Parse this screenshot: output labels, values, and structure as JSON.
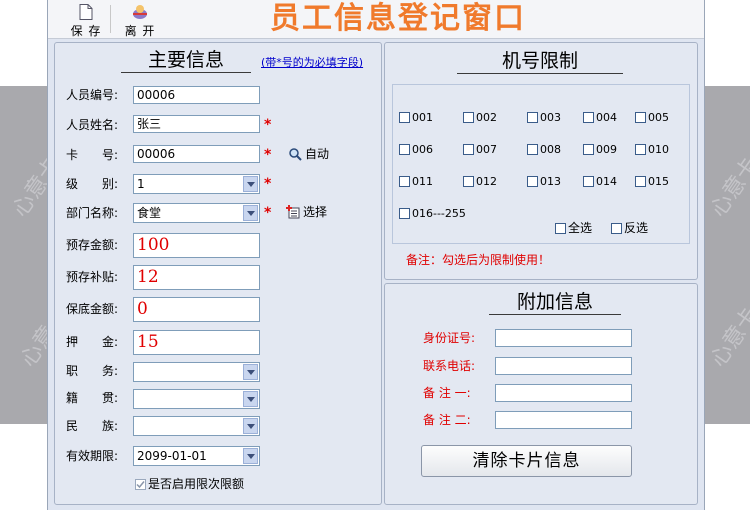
{
  "title": "员工信息登记窗口",
  "toolbar": {
    "save": "保 存",
    "exit": "离 开"
  },
  "watermark": "心意卡",
  "main": {
    "title": "主要信息",
    "subtitle": "(带*号的为必填字段)",
    "labels": {
      "emp_no": "人员编号:",
      "emp_name": "人员姓名:",
      "card_no": "卡　　号:",
      "level": "级　　别:",
      "dept": "部门名称:",
      "prepaid": "预存金额:",
      "subsidy": "预存补贴:",
      "min_amount": "保底金额:",
      "deposit": "押　　金:",
      "position": "职　　务:",
      "origin": "籍　　贯:",
      "ethnic": "民　　族:",
      "expiry": "有效期限:"
    },
    "values": {
      "emp_no": "00006",
      "emp_name": "张三",
      "card_no": "00006",
      "level": "1",
      "dept": "食堂",
      "prepaid": "100",
      "subsidy": "12",
      "min_amount": "0",
      "deposit": "15",
      "position": "",
      "origin": "",
      "ethnic": "",
      "expiry": "2099-01-01"
    },
    "auto_label": "自动",
    "select_label": "选择",
    "limit_checkbox": "是否启用限次限额",
    "star": "*"
  },
  "machine": {
    "title": "机号限制",
    "items": [
      "001",
      "002",
      "003",
      "004",
      "005",
      "006",
      "007",
      "008",
      "009",
      "010",
      "011",
      "012",
      "013",
      "014",
      "015",
      "016---255"
    ],
    "select_all": "全选",
    "invert": "反选",
    "note": "备注：勾选后为限制使用！"
  },
  "extra": {
    "title": "附加信息",
    "id_card": "身份证号:",
    "phone": "联系电话:",
    "note1": "备 注 一:",
    "note2": "备 注 二:",
    "clear_button": "清除卡片信息"
  },
  "colors": {
    "title": "#f07a2c",
    "required": "#e00000",
    "link": "#0000cc"
  }
}
